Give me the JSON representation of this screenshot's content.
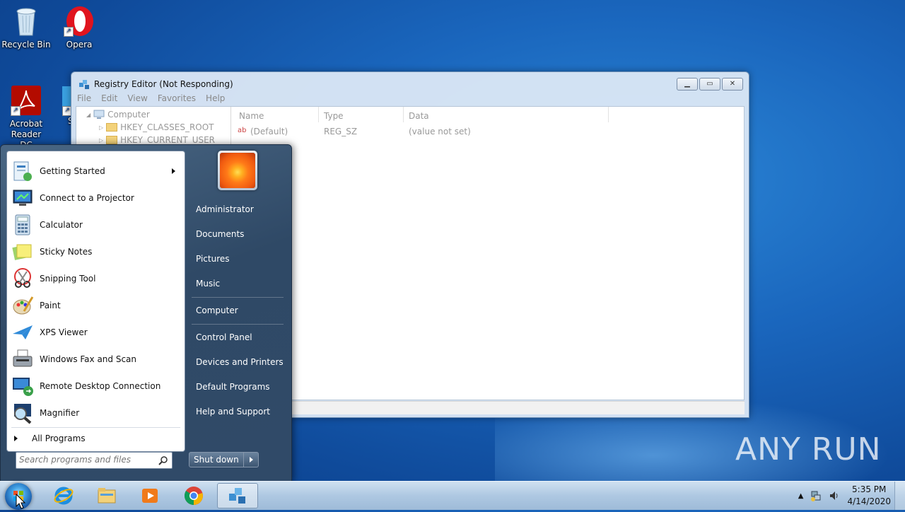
{
  "desktop": {
    "icons": [
      {
        "label": "Recycle Bin",
        "icon": "recycle-bin-icon"
      },
      {
        "label": "Opera",
        "icon": "opera-icon"
      },
      {
        "label": "Acrobat Reader DC",
        "icon": "acrobat-reader-icon"
      },
      {
        "label": "S",
        "icon": "shortcut-icon"
      }
    ],
    "watermark": "ANY RUN"
  },
  "registry_window": {
    "title": "Registry Editor (Not Responding)",
    "menu": [
      "File",
      "Edit",
      "View",
      "Favorites",
      "Help"
    ],
    "tree": {
      "root": "Computer",
      "items": [
        "HKEY_CLASSES_ROOT",
        "HKEY_CURRENT_USER"
      ]
    },
    "columns": [
      "Name",
      "Type",
      "Data"
    ],
    "rows": [
      {
        "name": "(Default)",
        "type": "REG_SZ",
        "data": "(value not set)"
      }
    ]
  },
  "start_menu": {
    "programs": [
      {
        "label": "Getting Started",
        "icon": "getting-started-icon",
        "submenu": true
      },
      {
        "label": "Connect to a Projector",
        "icon": "projector-icon"
      },
      {
        "label": "Calculator",
        "icon": "calculator-icon"
      },
      {
        "label": "Sticky Notes",
        "icon": "sticky-notes-icon"
      },
      {
        "label": "Snipping Tool",
        "icon": "snipping-tool-icon"
      },
      {
        "label": "Paint",
        "icon": "paint-icon"
      },
      {
        "label": "XPS Viewer",
        "icon": "xps-viewer-icon"
      },
      {
        "label": "Windows Fax and Scan",
        "icon": "fax-scan-icon"
      },
      {
        "label": "Remote Desktop Connection",
        "icon": "remote-desktop-icon"
      },
      {
        "label": "Magnifier",
        "icon": "magnifier-icon"
      }
    ],
    "all_programs": "All Programs",
    "search_placeholder": "Search programs and files",
    "right_links": [
      "Administrator",
      "Documents",
      "Pictures",
      "Music",
      "Computer",
      "Control Panel",
      "Devices and Printers",
      "Default Programs",
      "Help and Support"
    ],
    "shutdown_label": "Shut down"
  },
  "taskbar": {
    "items": [
      "internet-explorer-icon",
      "windows-explorer-icon",
      "media-player-icon",
      "chrome-icon",
      "regedit-icon"
    ],
    "clock": {
      "time": "5:35 PM",
      "date": "4/14/2020"
    }
  }
}
